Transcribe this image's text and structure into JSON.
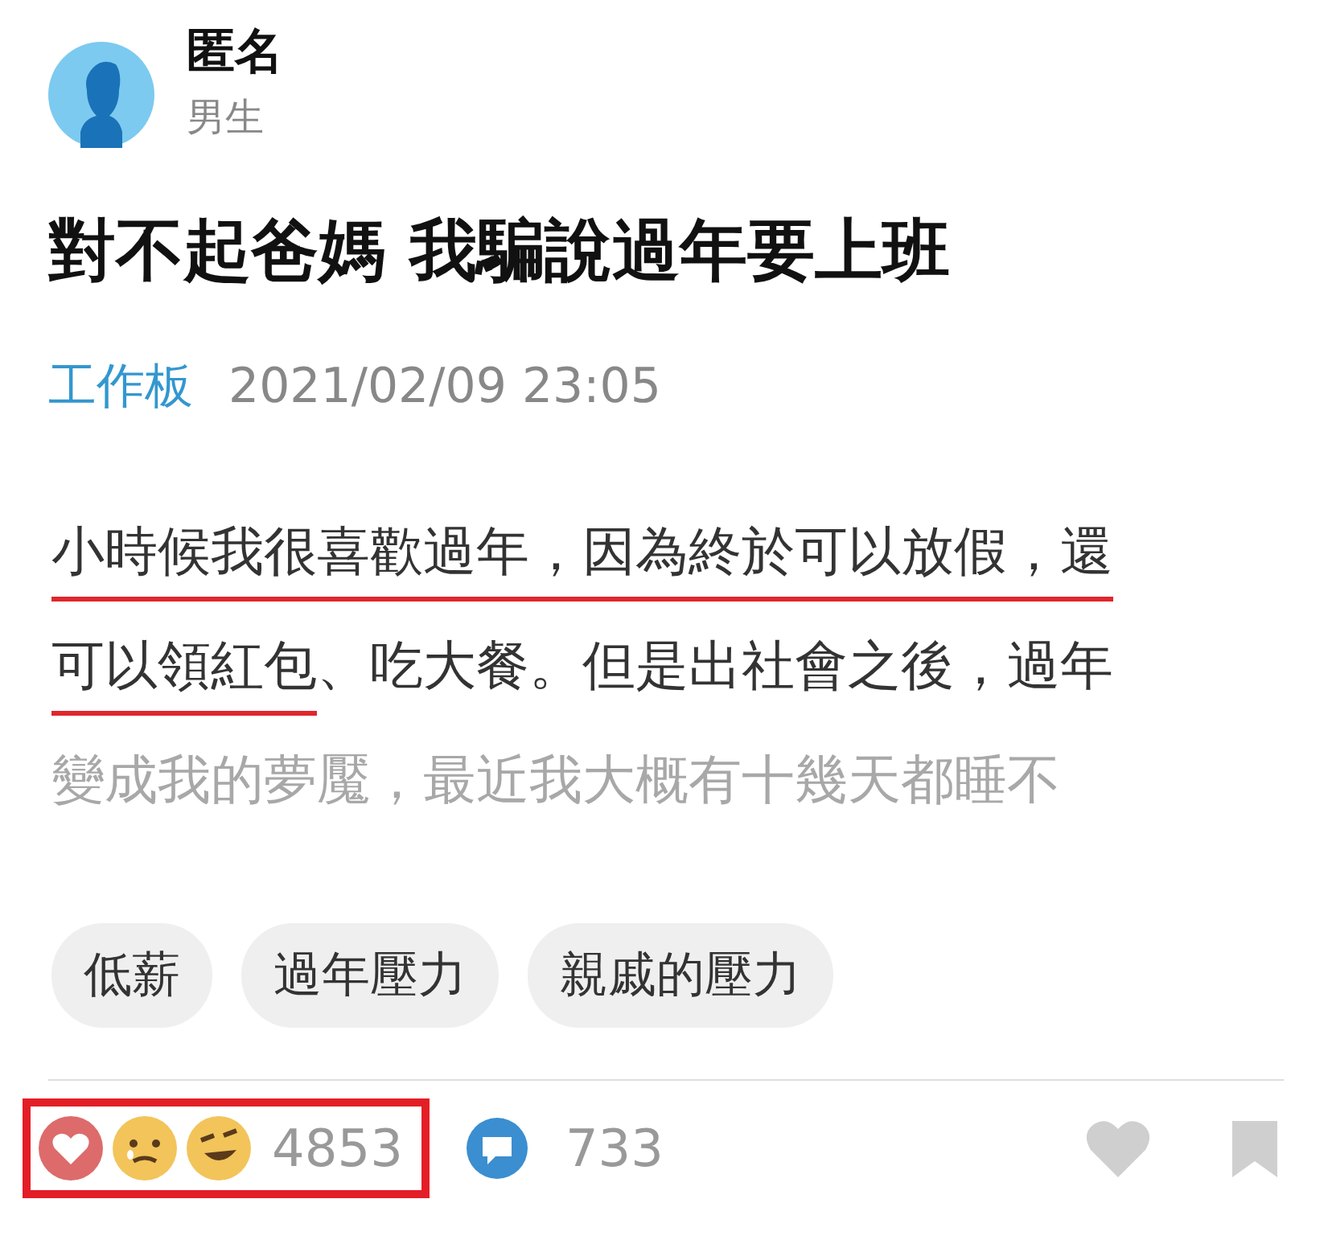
{
  "author": {
    "name": "匿名",
    "gender": "男生"
  },
  "title": "對不起爸媽 我騙說過年要上班",
  "meta": {
    "board": "工作板",
    "datetime": "2021/02/09 23:05"
  },
  "body_lines": [
    {
      "faded": false,
      "segments": [
        {
          "text": "小時候我很喜歡過年，因為終於可以放假，還",
          "underlined": true
        }
      ]
    },
    {
      "faded": false,
      "segments": [
        {
          "text": "可以領紅包",
          "underlined": true
        },
        {
          "text": "、吃大餐。但是出社會之後，過年",
          "underlined": false
        }
      ]
    },
    {
      "faded": true,
      "segments": [
        {
          "text": "變成我的夢魘，最近我大概有十幾天都睡不",
          "underlined": false
        }
      ]
    }
  ],
  "tags": [
    "低薪",
    "過年壓力",
    "親戚的壓力"
  ],
  "footer": {
    "reactions": {
      "count": "4853",
      "highlighted": true
    },
    "comments": {
      "count": "733"
    },
    "liked": false,
    "saved": false
  }
}
